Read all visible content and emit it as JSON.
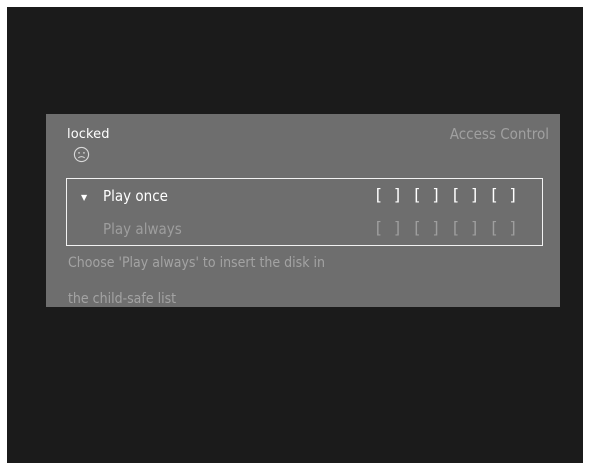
{
  "dialog": {
    "status": "locked",
    "status_icon": "sad-face-icon",
    "title": "Access Control",
    "options": [
      {
        "label": "Play once",
        "code": "[ ] [ ] [ ] [ ]",
        "selected": true
      },
      {
        "label": "Play always",
        "code": "[ ] [ ] [ ] [ ]",
        "selected": false
      }
    ],
    "help": [
      "Choose 'Play always' to insert the disk in",
      "the child-safe list"
    ]
  },
  "colors": {
    "screen_background": "#1b1b1b",
    "panel_background": "#6e6e6e",
    "active_text": "#ffffff",
    "inactive_text": "#9e9e9e"
  }
}
